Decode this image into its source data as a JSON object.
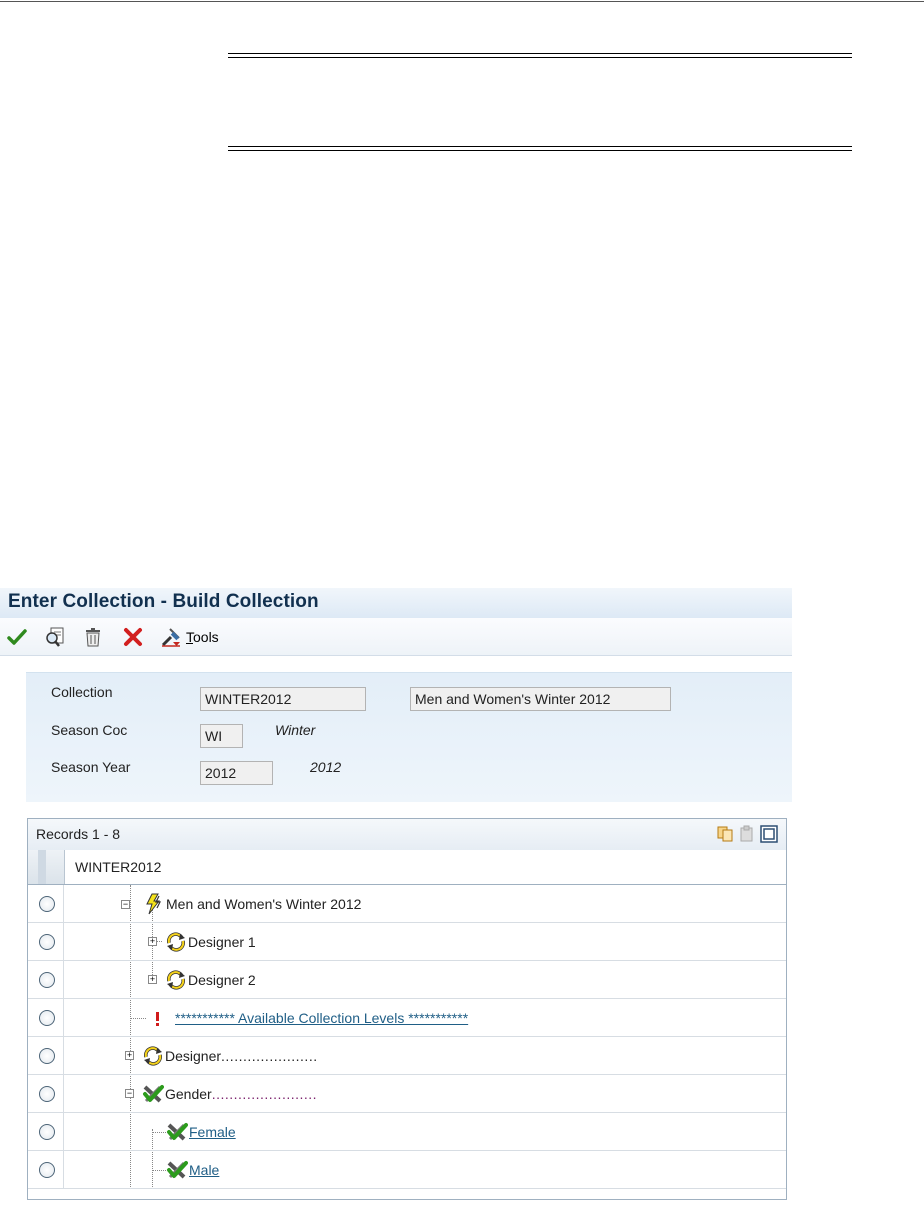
{
  "window": {
    "title": "Enter Collection - Build Collection"
  },
  "toolbar": {
    "ok_icon": "check-icon",
    "find_icon": "find-icon",
    "delete_icon": "trash-icon",
    "cancel_icon": "cancel-x-icon",
    "tools_label_prefix": "",
    "tools_label_underlined": "T",
    "tools_label_rest": "ools"
  },
  "header": {
    "collection_label": "Collection",
    "collection_value": "WINTER2012",
    "collection_desc": "Men and Women's Winter 2012",
    "season_code_label": "Season Coc",
    "season_code_value": "WI",
    "season_code_desc": "Winter",
    "season_year_label": "Season Year",
    "season_year_value": "2012",
    "season_year_desc": "2012"
  },
  "grid": {
    "records_label": "Records 1 - 8",
    "column_header": "WINTER2012",
    "rows": [
      {
        "label": "Men and Women's Winter 2012",
        "icon": "lightning-icon",
        "level": 0,
        "expander": "minus"
      },
      {
        "label": "Designer 1",
        "icon": "refresh-icon",
        "level": 1,
        "expander": "plus"
      },
      {
        "label": "Designer 2",
        "icon": "refresh-icon",
        "level": 1,
        "expander": "plus"
      },
      {
        "label": "*********** Available Collection Levels ***********",
        "icon": "exclamation-icon",
        "level": 0,
        "link": true
      },
      {
        "label": "Designer",
        "dots": "......................",
        "icon": "refresh-icon",
        "level": 0,
        "expander": "plus"
      },
      {
        "label": "Gender",
        "dots": "........................",
        "icon": "check-tools-icon",
        "level": 0,
        "expander": "minus"
      },
      {
        "label": "Female",
        "icon": "check-tools-icon",
        "level": 1,
        "link": true
      },
      {
        "label": "Male",
        "icon": "check-tools-icon",
        "level": 1,
        "link": true
      }
    ]
  },
  "colors": {
    "title_text": "#11304f",
    "link": "#1f5e86",
    "dots_purple": "#7a1f6b",
    "header_panel": "#e3eef8"
  }
}
